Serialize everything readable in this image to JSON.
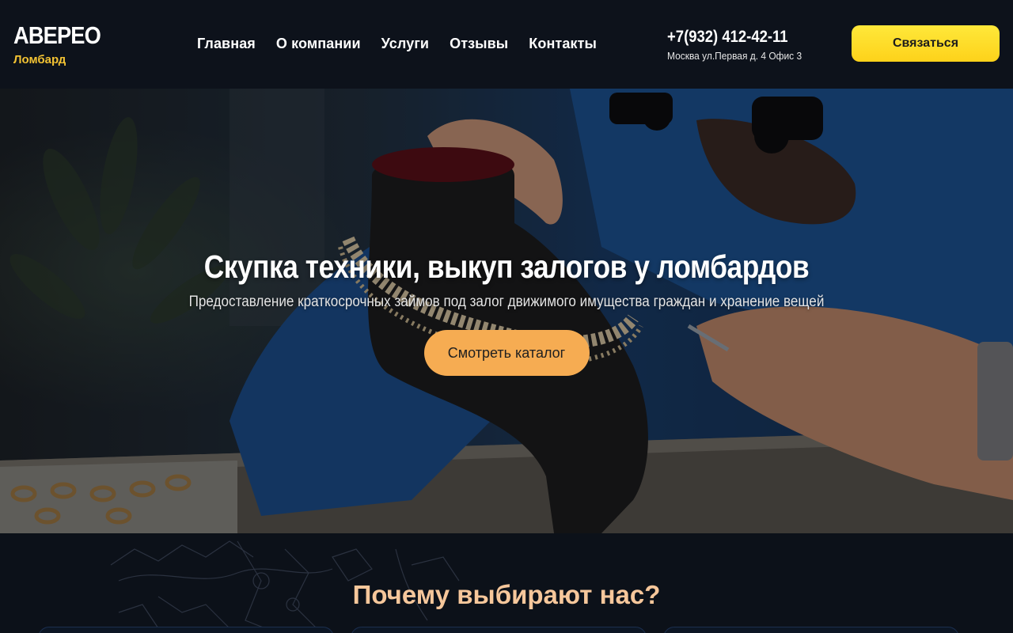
{
  "brand": {
    "name": "АВЕРЕО",
    "subtitle": "Ломбард",
    "accent_color": "#f2c233"
  },
  "nav": {
    "items": [
      {
        "label": "Главная"
      },
      {
        "label": "О компании"
      },
      {
        "label": "Услуги"
      },
      {
        "label": "Отзывы"
      },
      {
        "label": "Контакты"
      }
    ]
  },
  "contact": {
    "phone": "+7(932) 412-42-11",
    "address": "Москва ул.Первая д. 4 Офис 3",
    "button_label": "Связаться",
    "button_color": "#fdd21a"
  },
  "hero": {
    "title": "Скупка техники, выкуп залогов у ломбардов",
    "subtitle": "Предоставление краткосрочных займов под залог движимого имущества граждан и хранение вещей",
    "button_label": "Смотреть каталог",
    "button_color": "#f6ac52"
  },
  "why": {
    "title": "Почему выбирают нас?",
    "title_color": "#f6c79b"
  }
}
